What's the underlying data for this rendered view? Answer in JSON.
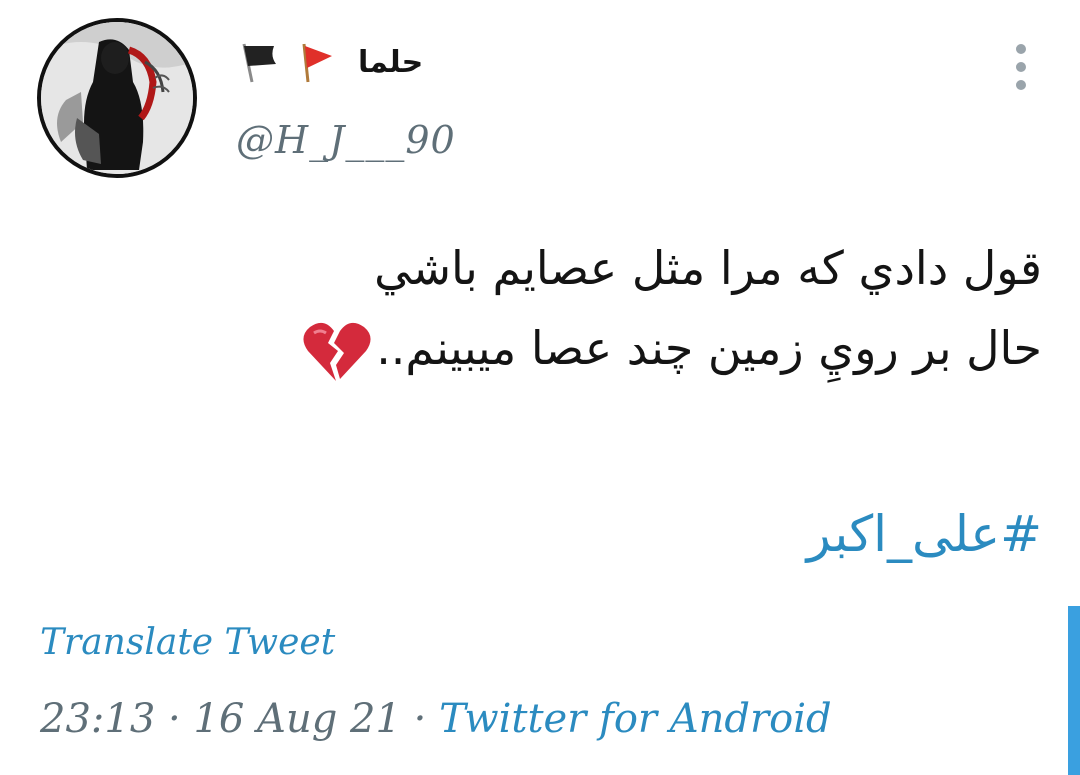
{
  "tweet": {
    "display_name": "حلما",
    "flags": [
      "black-flag-icon",
      "red-triangular-flag-icon"
    ],
    "handle": "@H_J___90",
    "text_lines": [
      "قول دادي كه مرا مثل عصايم باشي",
      "حال بر رويِ زمين چند عصا ميبينم.."
    ],
    "emoji": "broken-heart-icon",
    "hashtag": "#على_اكبر",
    "translate_label": "Translate Tweet",
    "time": "23:13",
    "separator": "·",
    "date": "16 Aug 21",
    "source": "Twitter for Android"
  },
  "colors": {
    "link": "#2b8bc0",
    "muted": "#5f6f78",
    "text": "#141414",
    "scroll_indicator": "#3aa0e0"
  }
}
